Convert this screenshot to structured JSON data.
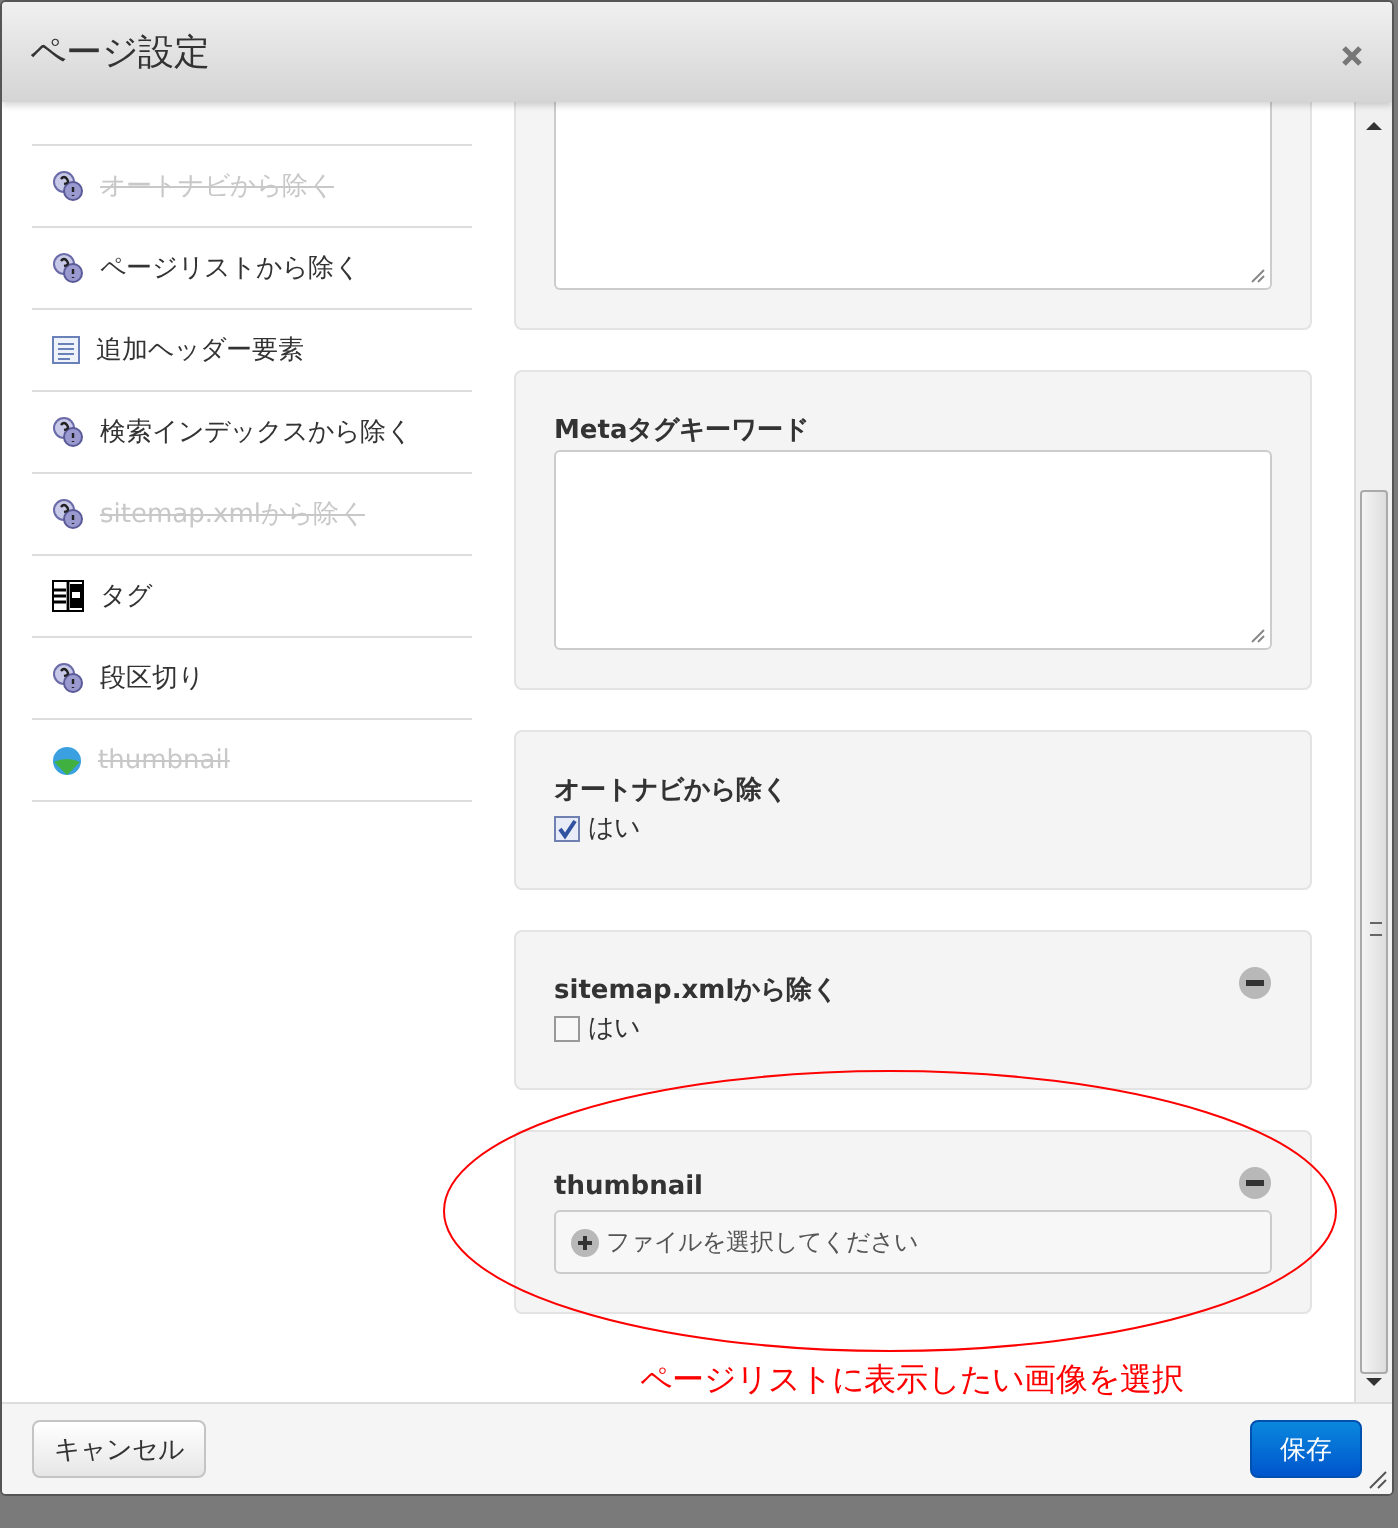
{
  "window": {
    "title": "ページ設定"
  },
  "sidebar": {
    "items": [
      {
        "label": "オートナビから除く",
        "kind": "help",
        "struck": true
      },
      {
        "label": "ページリストから除く",
        "kind": "help",
        "struck": false
      },
      {
        "label": "追加ヘッダー要素",
        "kind": "document",
        "struck": false
      },
      {
        "label": "検索インデックスから除く",
        "kind": "help",
        "struck": false
      },
      {
        "label": "sitemap.xmlから除く",
        "kind": "help",
        "struck": true
      },
      {
        "label": "タグ",
        "kind": "table",
        "struck": false
      },
      {
        "label": "段区切り",
        "kind": "help",
        "struck": false
      },
      {
        "label": "thumbnail",
        "kind": "globe",
        "struck": true
      }
    ]
  },
  "panels": [
    {
      "kind": "textarea"
    },
    {
      "kind": "textarea",
      "label": "Metaタグキーワード",
      "removable": false
    },
    {
      "kind": "checkbox",
      "label": "オートナビから除く",
      "option": "はい",
      "checked": true,
      "removable": false
    },
    {
      "kind": "checkbox",
      "label": "sitemap.xmlから除く",
      "option": "はい",
      "checked": false,
      "removable": true
    },
    {
      "kind": "file",
      "label": "thumbnail",
      "placeholder": "ファイルを選択してください",
      "removable": true
    }
  ],
  "annotation": {
    "text": "ページリストに表示したい画像を選択"
  },
  "buttons": {
    "cancel": "キャンセル",
    "save": "保存"
  }
}
